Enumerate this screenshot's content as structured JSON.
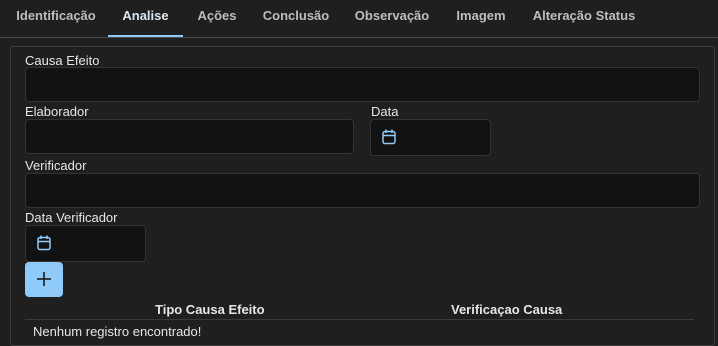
{
  "tabs": [
    {
      "label": "Identificação"
    },
    {
      "label": "Analise"
    },
    {
      "label": "Ações"
    },
    {
      "label": "Conclusão"
    },
    {
      "label": "Observação"
    },
    {
      "label": "Imagem"
    },
    {
      "label": "Alteração Status"
    }
  ],
  "active_tab": "Analise",
  "form": {
    "causa_efeito_label": "Causa Efeito",
    "causa_efeito_value": "",
    "elaborador_label": "Elaborador",
    "elaborador_value": "",
    "data_label": "Data",
    "verificador_label": "Verificador",
    "verificador_value": "",
    "data_verificador_label": "Data Verificador"
  },
  "table": {
    "columns": [
      "Tipo Causa Efeito",
      "Verificaçao Causa"
    ],
    "empty_message": "Nenhum registro encontrado!"
  },
  "colors": {
    "accent": "#90caf9",
    "background": "#1f1f1f",
    "input_background": "#121212"
  }
}
